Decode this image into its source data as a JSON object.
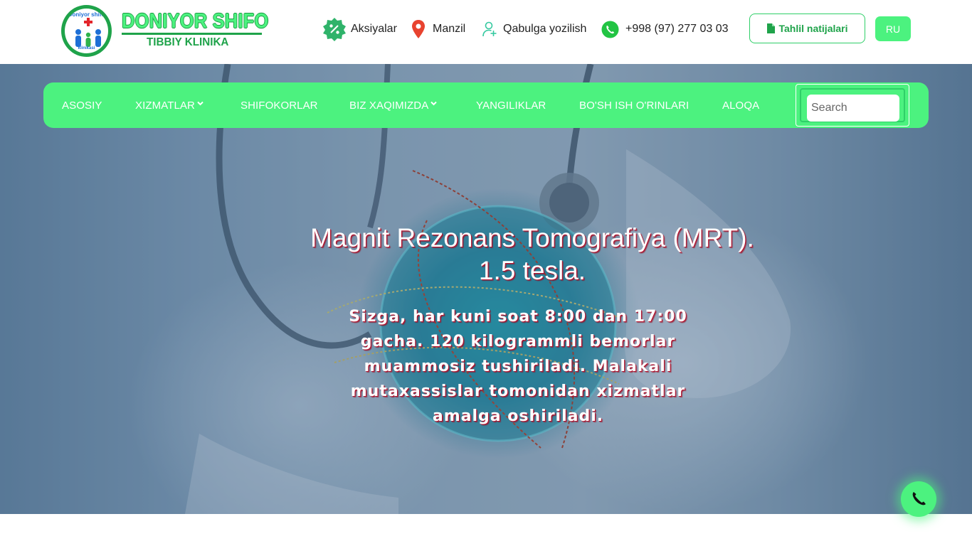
{
  "brand": {
    "name": "DONIYOR SHIFO",
    "subtitle": "TIBBIY KLINIKA",
    "logo_text_top": "Doniyor shifo",
    "logo_text_bottom": "klinikasi"
  },
  "top_links": [
    {
      "label": "Aksiyalar",
      "icon": "discount-badge-icon"
    },
    {
      "label": "Manzil",
      "icon": "location-pin-icon"
    },
    {
      "label": "Qabulga yozilish",
      "icon": "add-user-icon"
    },
    {
      "label": "+998 (97) 277 03 03",
      "icon": "whatsapp-phone-icon"
    }
  ],
  "results_button": {
    "label": "Tahlil natijalari",
    "icon": "document-icon"
  },
  "lang_button": {
    "label": "RU"
  },
  "nav": {
    "items": [
      {
        "label": "ASOSIY",
        "dropdown": false
      },
      {
        "label": "XIZMATLAR",
        "dropdown": true
      },
      {
        "label": "SHIFOKORLAR",
        "dropdown": false
      },
      {
        "label": "BIZ XAQIMIZDA",
        "dropdown": true
      },
      {
        "label": "YANGILIKLAR",
        "dropdown": false
      },
      {
        "label": "BO'SH ISH O'RINLARI",
        "dropdown": false
      },
      {
        "label": "ALOQA",
        "dropdown": false
      }
    ],
    "search_placeholder": "Search"
  },
  "hero": {
    "title": "Magnit Rezonans Tomografiya (MRT). 1.5 tesla.",
    "text": "Sizga, har kuni soat 8:00 dan 17:00 gacha. 120 kilogrammli bemorlar muammosiz tushiriladi. Malakali mutaxassislar tomonidan xizmatlar amalga oshiriladi."
  },
  "call_button": {
    "icon": "phone-icon"
  },
  "colors": {
    "accent": "#4cf27f",
    "accent_dark": "#1fa34a",
    "text_shadow": "#b3122e"
  }
}
